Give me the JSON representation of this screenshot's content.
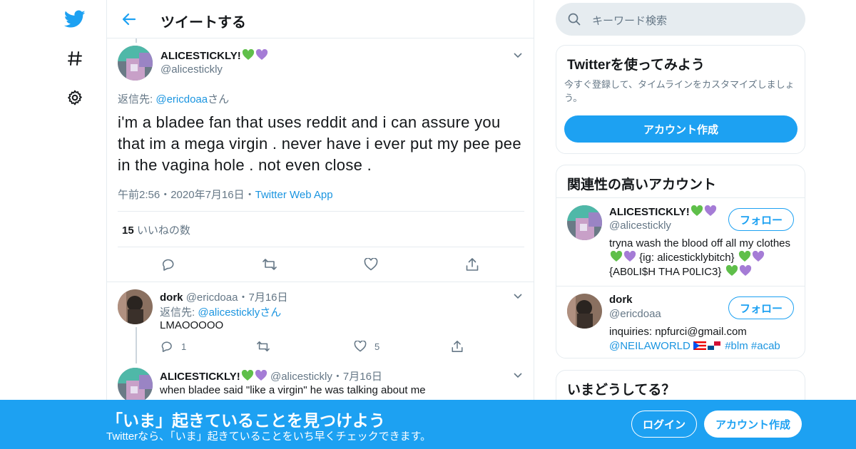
{
  "colors": {
    "accent": "#1da1f2",
    "link": "#1b95e0",
    "muted": "#657786",
    "border": "#e6ecf0",
    "green_heart": "#5fbf4a",
    "purple_heart": "#a57cd6"
  },
  "nav": {
    "items": [
      {
        "icon": "twitter-bird-icon"
      },
      {
        "icon": "hashtag-icon"
      },
      {
        "icon": "gear-icon"
      }
    ]
  },
  "header": {
    "title": "ツイートする",
    "back_icon": "back-arrow-icon"
  },
  "tweet": {
    "name": "ALICESTICKLY!",
    "handle": "@alicestickly",
    "reply_to_prefix": "返信先: ",
    "reply_to_handle": "@ericdoaa",
    "reply_to_suffix": "さん",
    "text": "i'm a bladee fan that uses reddit and i can assure you that im a mega virgin . never have i ever put my pee pee in the vagina hole . not even close .",
    "time": "午前2:56",
    "date": "2020年7月16日",
    "source": "Twitter Web App",
    "likes_count": "15",
    "likes_label": "いいねの数",
    "separator": "・"
  },
  "replies": [
    {
      "name": "dork",
      "handle": "@ericdoaa",
      "date": "7月16日",
      "reply_to_prefix": "返信先: ",
      "reply_to_handle": "@alicesticklyさん",
      "text": "LMAOOOOO",
      "reply_count": "1",
      "like_count": "5"
    },
    {
      "name": "ALICESTICKLY!",
      "handle": "@alicestickly",
      "date": "7月16日",
      "text": "when bladee said \"like a virgin\" he was talking about me"
    }
  ],
  "sidebar": {
    "search_placeholder": "キーワード検索",
    "signup_card": {
      "title": "Twitterを使ってみよう",
      "body": "今すぐ登録して、タイムラインをカスタマイズしましょう。",
      "button": "アカウント作成"
    },
    "related": {
      "title": "関連性の高いアカウント",
      "accounts": [
        {
          "name": "ALICESTICKLY!",
          "handle": "@alicestickly",
          "follow": "フォロー",
          "bio_1": "tryna wash the blood off all my clothes",
          "bio_2": "{ig: alicesticklybitch}",
          "bio_3": "{AB0LI$H THA P0LIC3}"
        },
        {
          "name": "dork",
          "handle": "@ericdoaa",
          "follow": "フォロー",
          "bio_1": "inquiries: npfurci@gmail.com",
          "bio_link": "@NEILAWORLD",
          "bio_tags": "#blm #acab"
        }
      ]
    },
    "trends_title": "いまどうしてる？"
  },
  "banner": {
    "title": "「いま」起きていることを見つけよう",
    "subtitle": "Twitterなら、「いま」起きていることをいち早くチェックできます。",
    "login": "ログイン",
    "signup": "アカウント作成"
  }
}
